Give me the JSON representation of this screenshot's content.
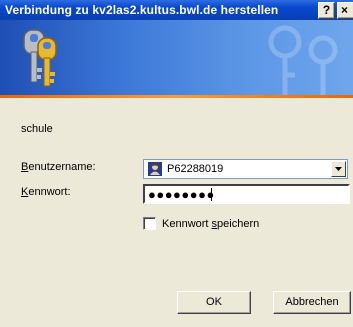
{
  "window": {
    "title": "Verbindung zu kv2las2.kultus.bwl.de herstellen",
    "help_label": "?",
    "close_label": "×"
  },
  "dialog": {
    "realm": "schule",
    "username_label_hotkey": "B",
    "username_label_rest": "enutzername:",
    "username_value": "P62288019",
    "password_label_hotkey": "K",
    "password_label_rest": "ennwort:",
    "password_value": "●●●●●●●●",
    "remember_label_prefix": "Kennwort ",
    "remember_label_hotkey": "s",
    "remember_label_rest": "peichern",
    "remember_checked": false
  },
  "buttons": {
    "ok": "OK",
    "cancel": "Abbrechen"
  },
  "colors": {
    "titlebar": "#0A49CE",
    "banner": "#3C78D8",
    "accent_line": "#E56A06",
    "dialog_bg": "#ECE9D8"
  }
}
